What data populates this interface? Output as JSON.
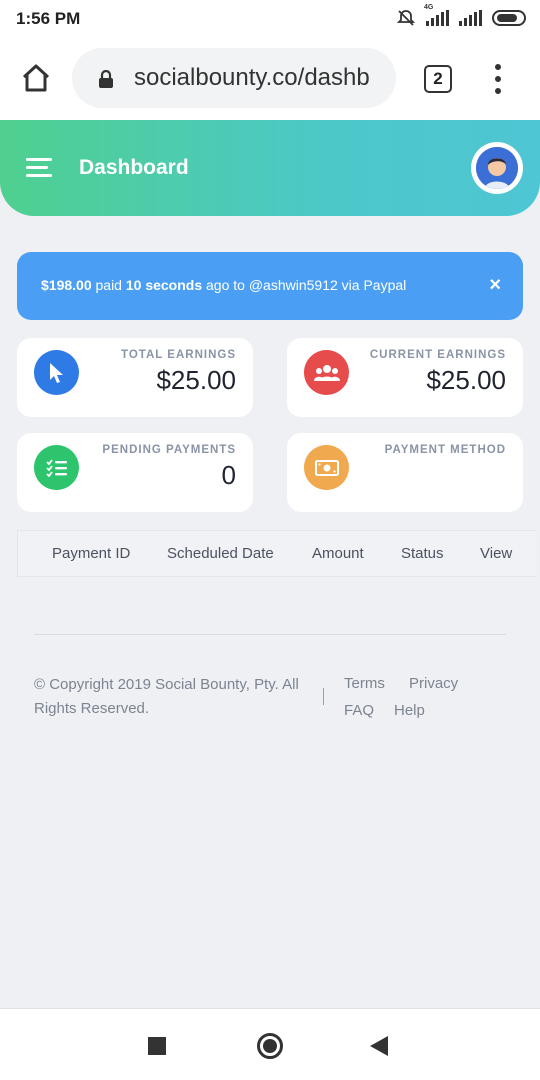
{
  "status_bar": {
    "time": "1:56 PM",
    "network": "4G"
  },
  "browser": {
    "url": "socialbounty.co/dashb",
    "tab_count": "2"
  },
  "header": {
    "title": "Dashboard"
  },
  "alert": {
    "amount": "$198.00",
    "paid_text": " paid ",
    "elapsed": "10 seconds",
    "ago_text": " ago to @ashwin5912 via Paypal",
    "close": "×"
  },
  "cards": {
    "total_earnings": {
      "label": "TOTAL EARNINGS",
      "value": "$25.00",
      "icon": "cursor-icon",
      "color": "#2e7be6"
    },
    "current_earnings": {
      "label": "CURRENT EARNINGS",
      "value": "$25.00",
      "icon": "users-icon",
      "color": "#e74c4c"
    },
    "pending_payments": {
      "label": "PENDING PAYMENTS",
      "value": "0",
      "icon": "checklist-icon",
      "color": "#2ec46d"
    },
    "payment_method": {
      "label": "PAYMENT METHOD",
      "value": "",
      "icon": "money-icon",
      "color": "#f0a94e"
    }
  },
  "table": {
    "columns": [
      "Payment ID",
      "Scheduled Date",
      "Amount",
      "Status",
      "View"
    ]
  },
  "footer": {
    "copyright": "© Copyright 2019 Social Bounty, Pty. All Rights Reserved.",
    "links": [
      "Terms",
      "Privacy",
      "FAQ",
      "Help"
    ]
  },
  "colors": {
    "header_gradient_start": "#4fd08f",
    "header_gradient_end": "#4fc6d4",
    "alert_bg": "#4a9ff5"
  }
}
